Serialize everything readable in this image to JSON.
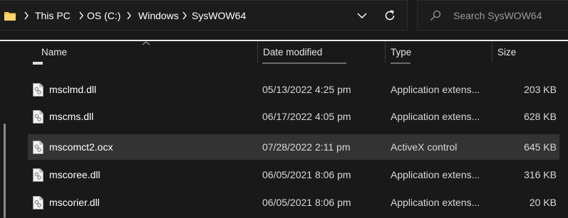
{
  "address_bar": {
    "breadcrumbs": [
      "This PC",
      "OS (C:)",
      "Windows",
      "SysWOW64"
    ],
    "folder_icon": "folder-icon",
    "dropdown_icon": "chevron-down-icon",
    "refresh_icon": "refresh-icon"
  },
  "search": {
    "placeholder": "Search SysWOW64",
    "value": "",
    "icon": "search-icon"
  },
  "columns": {
    "name": "Name",
    "date_modified": "Date modified",
    "type": "Type",
    "size": "Size"
  },
  "files": [
    {
      "name": "msclmd.dll",
      "date_modified": "05/13/2022 4:25 pm",
      "type": "Application extens...",
      "size": "203 KB",
      "selected": false,
      "icon": "dll-file-icon"
    },
    {
      "name": "mscms.dll",
      "date_modified": "06/17/2022 4:05 pm",
      "type": "Application extens...",
      "size": "628 KB",
      "selected": false,
      "icon": "dll-file-icon"
    },
    {
      "name": "mscomct2.ocx",
      "date_modified": "07/28/2022 2:11 pm",
      "type": "ActiveX control",
      "size": "645 KB",
      "selected": true,
      "icon": "ocx-file-icon"
    },
    {
      "name": "mscoree.dll",
      "date_modified": "06/05/2021 8:06 pm",
      "type": "Application extens...",
      "size": "316 KB",
      "selected": false,
      "icon": "dll-file-icon"
    },
    {
      "name": "mscorier.dll",
      "date_modified": "06/05/2021 8:06 pm",
      "type": "Application extens...",
      "size": "20 KB",
      "selected": false,
      "icon": "dll-file-icon"
    }
  ],
  "colors": {
    "background": "#191919",
    "selected_row": "#333333",
    "text": "#ffffff",
    "muted_text": "#d9d9d9",
    "accent_folder": "#f4c542"
  }
}
